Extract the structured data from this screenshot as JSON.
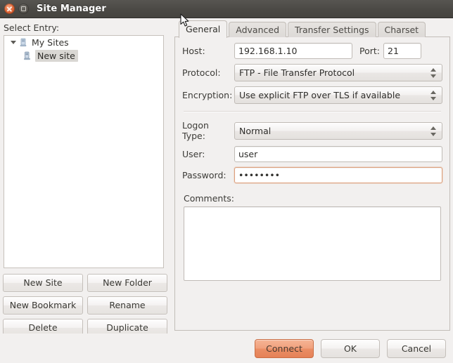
{
  "window": {
    "title": "Site Manager",
    "close_icon": "close-icon",
    "maximize_icon": "maximize-icon"
  },
  "left_pane": {
    "select_entry_label": "Select Entry:",
    "tree": [
      {
        "label": "My Sites",
        "icon": "server-icon",
        "expanded": true,
        "selected": false,
        "level": 0
      },
      {
        "label": "New site",
        "icon": "server-icon",
        "expanded": false,
        "selected": true,
        "level": 1
      }
    ],
    "buttons": [
      {
        "label": "New Site"
      },
      {
        "label": "New Folder"
      },
      {
        "label": "New Bookmark"
      },
      {
        "label": "Rename"
      },
      {
        "label": "Delete"
      },
      {
        "label": "Duplicate"
      }
    ]
  },
  "tabs": [
    {
      "label": "General",
      "active": true
    },
    {
      "label": "Advanced",
      "active": false
    },
    {
      "label": "Transfer Settings",
      "active": false
    },
    {
      "label": "Charset",
      "active": false
    }
  ],
  "general_tab": {
    "host": {
      "label": "Host:",
      "value": "192.168.1.10"
    },
    "port": {
      "label": "Port:",
      "value": "21"
    },
    "protocol": {
      "label": "Protocol:",
      "value": "FTP - File Transfer Protocol"
    },
    "encryption": {
      "label": "Encryption:",
      "value": "Use explicit FTP over TLS if available"
    },
    "logon_type": {
      "label": "Logon Type:",
      "value": "Normal"
    },
    "user": {
      "label": "User:",
      "value": "user"
    },
    "password": {
      "label": "Password:",
      "value": "••••••••",
      "focused": true
    },
    "comments": {
      "label": "Comments:",
      "value": ""
    }
  },
  "actions": [
    {
      "label": "Connect",
      "default": true
    },
    {
      "label": "OK",
      "default": false
    },
    {
      "label": "Cancel",
      "default": false
    }
  ],
  "colors": {
    "titlebar": "#4b4945",
    "dialog_bg": "#f2f0ef",
    "accent_orange": "#ea8e65",
    "focus_border": "#dda07c",
    "selection": "#d9d7d3"
  }
}
